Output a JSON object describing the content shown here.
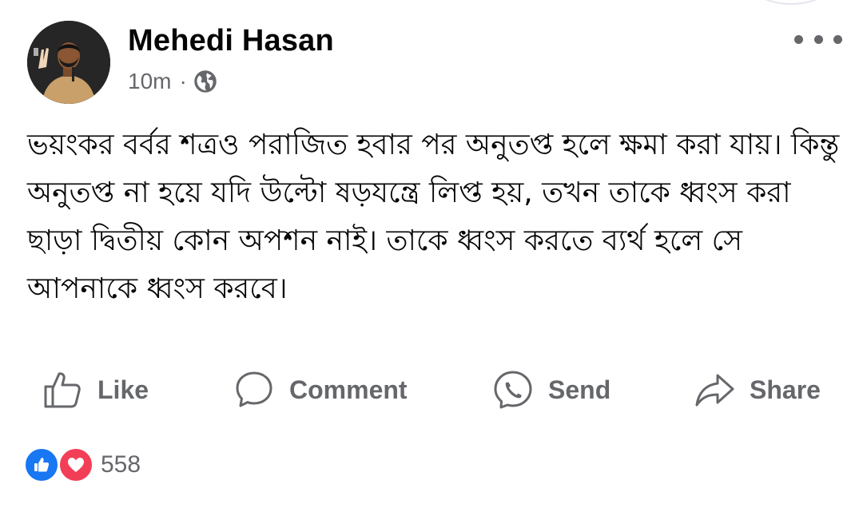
{
  "post": {
    "author": "Mehedi Hasan",
    "time": "10m",
    "separator": "·",
    "privacy_icon": "globe-icon",
    "more_icon": "more-horizontal-icon",
    "text": "ভয়ংকর বর্বর শত্রও পরাজিত হবার পর অনুতপ্ত হলে ক্ষমা করা যায়। কিন্তু অনুতপ্ত না হয়ে যদি উল্টো ষড়যন্ত্রে লিপ্ত হয়, তখন তাকে ধ্বংস করা ছাড়া দ্বিতীয় কোন অপশন নাই। তাকে ধ্বংস করতে ব্যর্থ হলে সে আপনাকে ধ্বংস করবে।"
  },
  "actions": {
    "like": {
      "label": "Like",
      "icon": "thumbs-up-icon"
    },
    "comment": {
      "label": "Comment",
      "icon": "comment-bubble-icon"
    },
    "send": {
      "label": "Send",
      "icon": "messenger-icon"
    },
    "share": {
      "label": "Share",
      "icon": "share-arrow-icon"
    }
  },
  "reactions": {
    "types": [
      "like",
      "love"
    ],
    "count": "558"
  },
  "colors": {
    "text_primary": "#050505",
    "text_secondary": "#65676b",
    "like_blue": "#1877f2",
    "love_red": "#f33e58"
  }
}
